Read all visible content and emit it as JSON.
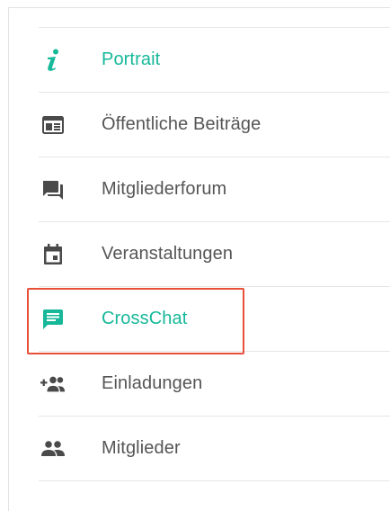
{
  "menu": {
    "items": [
      {
        "label": "Portrait",
        "icon": "info-icon",
        "active": true
      },
      {
        "label": "Öffentliche Beiträge",
        "icon": "newspaper-icon",
        "active": false
      },
      {
        "label": "Mitgliederforum",
        "icon": "forum-icon",
        "active": false
      },
      {
        "label": "Veranstaltungen",
        "icon": "calendar-icon",
        "active": false
      },
      {
        "label": "CrossChat",
        "icon": "chat-icon",
        "active": true
      },
      {
        "label": "Einladungen",
        "icon": "add-group-icon",
        "active": false
      },
      {
        "label": "Mitglieder",
        "icon": "group-icon",
        "active": false
      }
    ]
  },
  "colors": {
    "accent": "#16b899",
    "text": "#555555",
    "icon": "#4a4a4a",
    "highlight": "#e8503a",
    "divider": "#e6e6e6"
  }
}
